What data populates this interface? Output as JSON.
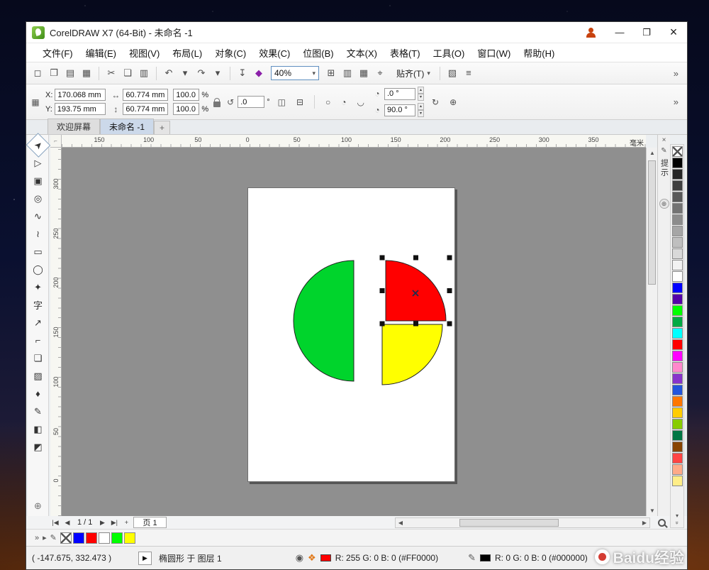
{
  "window": {
    "title": "CorelDRAW X7 (64-Bit) - 未命名 -1",
    "minimize_glyph": "—",
    "maximize_glyph": "❐",
    "close_glyph": "×"
  },
  "menu_bar": {
    "items": [
      "文件(F)",
      "编辑(E)",
      "视图(V)",
      "布局(L)",
      "对象(C)",
      "效果(C)",
      "位图(B)",
      "文本(X)",
      "表格(T)",
      "工具(O)",
      "窗口(W)",
      "帮助(H)"
    ]
  },
  "standard_toolbar": {
    "left_icons": [
      {
        "name": "new-document-icon",
        "glyph": "◻"
      },
      {
        "name": "open-icon",
        "glyph": "❐"
      },
      {
        "name": "save-icon",
        "glyph": "▤"
      },
      {
        "name": "print-icon",
        "glyph": "▦"
      },
      {
        "name": "separator"
      },
      {
        "name": "cut-icon",
        "glyph": "✂"
      },
      {
        "name": "copy-icon",
        "glyph": "❏"
      },
      {
        "name": "paste-icon",
        "glyph": "▥"
      },
      {
        "name": "separator"
      },
      {
        "name": "undo-icon",
        "glyph": "↶"
      },
      {
        "name": "undo-dropdown-icon",
        "glyph": "▾"
      },
      {
        "name": "redo-icon",
        "glyph": "↷"
      },
      {
        "name": "redo-dropdown-icon",
        "glyph": "▾"
      },
      {
        "name": "separator"
      },
      {
        "name": "import-icon",
        "glyph": "↧"
      },
      {
        "name": "app-launcher-icon",
        "glyph": "◆",
        "color": "#8b1fa9"
      }
    ],
    "zoom_level": "40%",
    "dropdown_glyph": "▾",
    "mid_icons": [
      {
        "name": "full-screen-preview-icon",
        "glyph": "⊞"
      },
      {
        "name": "show-rulers-icon",
        "glyph": "▥"
      },
      {
        "name": "show-grid-icon",
        "glyph": "▦"
      },
      {
        "name": "snap-target-icon",
        "glyph": "⌖"
      }
    ],
    "snap_label": "贴齐(T)",
    "trail_icons": [
      {
        "name": "options-icon",
        "glyph": "▧"
      },
      {
        "name": "hints-panel-icon",
        "glyph": "≡"
      }
    ],
    "overflow_glyph": "»"
  },
  "property_bar": {
    "grid_icon_glyph": "▦",
    "x_label": "X:",
    "x_value": "170.068 mm",
    "y_label": "Y:",
    "y_value": "193.75 mm",
    "width_icon_glyph": "↔",
    "width_value": "60.774 mm",
    "height_icon_glyph": "↕",
    "height_value": "60.774 mm",
    "scale_h": "100.0",
    "scale_v": "100.0",
    "percent": "%",
    "rotate_icon_glyph": "↺",
    "rotation_value": ".0",
    "degree": "°",
    "mirror_h_glyph": "◫",
    "mirror_v_glyph": "⊟",
    "ellipse_glyph": "○",
    "pie_glyph": "◔",
    "arc_glyph": "◡",
    "arc_icon_glyph": "◔",
    "arc_start_value": ".0 °",
    "arc_end_value": "90.0 °",
    "spin_up_glyph": "▴",
    "spin_down_glyph": "▾",
    "direction_glyph": "↻",
    "convert_glyph": "⊕",
    "overflow_glyph": "»"
  },
  "document_tabs": {
    "welcome": "欢迎屏幕",
    "current": "未命名 -1",
    "add_glyph": "+"
  },
  "rulers": {
    "horizontal_ticks": [
      "150",
      "100",
      "50",
      "0",
      "50",
      "100",
      "150",
      "200",
      "250",
      "300",
      "350"
    ],
    "vertical_ticks": [
      "300",
      "250",
      "200",
      "150",
      "100",
      "50",
      "0"
    ],
    "units": "毫米"
  },
  "toolbox": {
    "tools": [
      {
        "name": "pick-tool",
        "glyph": "➤",
        "active": true
      },
      {
        "name": "shape-tool",
        "glyph": "▷"
      },
      {
        "name": "crop-tool",
        "glyph": "▣"
      },
      {
        "name": "zoom-tool",
        "glyph": "◎"
      },
      {
        "name": "freehand-tool",
        "glyph": "∿"
      },
      {
        "name": "artistic-media-tool",
        "glyph": "≀"
      },
      {
        "name": "rectangle-tool",
        "glyph": "▭"
      },
      {
        "name": "ellipse-tool",
        "glyph": "◯"
      },
      {
        "name": "polygon-tool",
        "glyph": "✦"
      },
      {
        "name": "text-tool",
        "glyph": "字"
      },
      {
        "name": "dimension-tool",
        "glyph": "↗"
      },
      {
        "name": "connector-tool",
        "glyph": "⌐"
      },
      {
        "name": "drop-shadow-tool",
        "glyph": "❏"
      },
      {
        "name": "transparency-tool",
        "glyph": "▨"
      },
      {
        "name": "color-eyedropper-tool",
        "glyph": "♦"
      },
      {
        "name": "outline-pen-tool",
        "glyph": "✎"
      },
      {
        "name": "fill-tool",
        "glyph": "◧"
      },
      {
        "name": "interactive-fill-tool",
        "glyph": "◩"
      }
    ],
    "add_glyph": "⊕"
  },
  "canvas": {
    "shapes": [
      {
        "name": "green-semicircle",
        "fill": "#00d42c",
        "outline": "#222222"
      },
      {
        "name": "yellow-quarter",
        "fill": "#ffff00",
        "outline": "#222222"
      },
      {
        "name": "red-quarter",
        "fill": "#ff0000",
        "outline": "#222222",
        "selected": true
      }
    ],
    "selection": {
      "handle_color": "#101010"
    }
  },
  "hints_docker": {
    "close_glyph": "×",
    "edit_glyph": "✎",
    "label": "提示",
    "float_glyph": "⊕"
  },
  "color_palette": [
    "none",
    "#000000",
    "#262626",
    "#404040",
    "#595959",
    "#737373",
    "#8c8c8c",
    "#a6a6a6",
    "#bfbfbf",
    "#d9d9d9",
    "#f2f2f2",
    "#ffffff",
    "#0000ff",
    "#5500aa",
    "#00ff00",
    "#00aa44",
    "#00ffff",
    "#ff0000",
    "#ff00ff",
    "#ff88cc",
    "#8833cc",
    "#2255dd",
    "#ff7700",
    "#ffcc00",
    "#88cc00",
    "#007744",
    "#884400",
    "#ff4444",
    "#ffaa88",
    "#ffee88"
  ],
  "palette_controls": {
    "scroll_glyph": "▾",
    "expand_glyph": "»"
  },
  "page_controls": {
    "first_glyph": "|◀",
    "prev_glyph": "◀",
    "counter": "1 / 1",
    "next_glyph": "▶",
    "last_glyph": "▶|",
    "add_page_glyph": "+",
    "page_tab": "页 1"
  },
  "document_palette": {
    "overflow_glyph": "»",
    "flyout_glyph": "▸",
    "edit_glyph": "✎",
    "colors": [
      "none",
      "#0000ff",
      "#ff0000",
      "#ffffff",
      "#00ff00",
      "#ffff00"
    ]
  },
  "status_bar": {
    "cursor_pos": "( -147.675, 332.473 )",
    "play_glyph": "▶",
    "object_info": "椭圆形 于 图层 1",
    "doc_palette_icon_glyph": "◉",
    "nav_icon_glyph": "❖",
    "fill_color": "#ff0000",
    "fill_info": "R: 255 G: 0 B: 0 (#FF0000)",
    "pen_icon_glyph": "✎",
    "outline_color": "#000000",
    "outline_info": "R: 0 G: 0 B: 0 (#000000)"
  },
  "watermark": {
    "text": "Baidu经验"
  }
}
